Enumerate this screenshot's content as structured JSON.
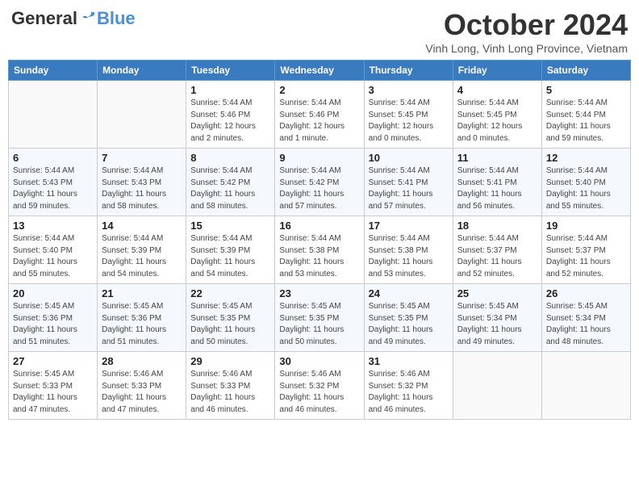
{
  "header": {
    "logo_general": "General",
    "logo_blue": "Blue",
    "month_title": "October 2024",
    "location": "Vinh Long, Vinh Long Province, Vietnam"
  },
  "days_of_week": [
    "Sunday",
    "Monday",
    "Tuesday",
    "Wednesday",
    "Thursday",
    "Friday",
    "Saturday"
  ],
  "weeks": [
    [
      {
        "day": "",
        "info": ""
      },
      {
        "day": "",
        "info": ""
      },
      {
        "day": "1",
        "info": "Sunrise: 5:44 AM\nSunset: 5:46 PM\nDaylight: 12 hours and 2 minutes."
      },
      {
        "day": "2",
        "info": "Sunrise: 5:44 AM\nSunset: 5:46 PM\nDaylight: 12 hours and 1 minute."
      },
      {
        "day": "3",
        "info": "Sunrise: 5:44 AM\nSunset: 5:45 PM\nDaylight: 12 hours and 0 minutes."
      },
      {
        "day": "4",
        "info": "Sunrise: 5:44 AM\nSunset: 5:45 PM\nDaylight: 12 hours and 0 minutes."
      },
      {
        "day": "5",
        "info": "Sunrise: 5:44 AM\nSunset: 5:44 PM\nDaylight: 11 hours and 59 minutes."
      }
    ],
    [
      {
        "day": "6",
        "info": "Sunrise: 5:44 AM\nSunset: 5:43 PM\nDaylight: 11 hours and 59 minutes."
      },
      {
        "day": "7",
        "info": "Sunrise: 5:44 AM\nSunset: 5:43 PM\nDaylight: 11 hours and 58 minutes."
      },
      {
        "day": "8",
        "info": "Sunrise: 5:44 AM\nSunset: 5:42 PM\nDaylight: 11 hours and 58 minutes."
      },
      {
        "day": "9",
        "info": "Sunrise: 5:44 AM\nSunset: 5:42 PM\nDaylight: 11 hours and 57 minutes."
      },
      {
        "day": "10",
        "info": "Sunrise: 5:44 AM\nSunset: 5:41 PM\nDaylight: 11 hours and 57 minutes."
      },
      {
        "day": "11",
        "info": "Sunrise: 5:44 AM\nSunset: 5:41 PM\nDaylight: 11 hours and 56 minutes."
      },
      {
        "day": "12",
        "info": "Sunrise: 5:44 AM\nSunset: 5:40 PM\nDaylight: 11 hours and 55 minutes."
      }
    ],
    [
      {
        "day": "13",
        "info": "Sunrise: 5:44 AM\nSunset: 5:40 PM\nDaylight: 11 hours and 55 minutes."
      },
      {
        "day": "14",
        "info": "Sunrise: 5:44 AM\nSunset: 5:39 PM\nDaylight: 11 hours and 54 minutes."
      },
      {
        "day": "15",
        "info": "Sunrise: 5:44 AM\nSunset: 5:39 PM\nDaylight: 11 hours and 54 minutes."
      },
      {
        "day": "16",
        "info": "Sunrise: 5:44 AM\nSunset: 5:38 PM\nDaylight: 11 hours and 53 minutes."
      },
      {
        "day": "17",
        "info": "Sunrise: 5:44 AM\nSunset: 5:38 PM\nDaylight: 11 hours and 53 minutes."
      },
      {
        "day": "18",
        "info": "Sunrise: 5:44 AM\nSunset: 5:37 PM\nDaylight: 11 hours and 52 minutes."
      },
      {
        "day": "19",
        "info": "Sunrise: 5:44 AM\nSunset: 5:37 PM\nDaylight: 11 hours and 52 minutes."
      }
    ],
    [
      {
        "day": "20",
        "info": "Sunrise: 5:45 AM\nSunset: 5:36 PM\nDaylight: 11 hours and 51 minutes."
      },
      {
        "day": "21",
        "info": "Sunrise: 5:45 AM\nSunset: 5:36 PM\nDaylight: 11 hours and 51 minutes."
      },
      {
        "day": "22",
        "info": "Sunrise: 5:45 AM\nSunset: 5:35 PM\nDaylight: 11 hours and 50 minutes."
      },
      {
        "day": "23",
        "info": "Sunrise: 5:45 AM\nSunset: 5:35 PM\nDaylight: 11 hours and 50 minutes."
      },
      {
        "day": "24",
        "info": "Sunrise: 5:45 AM\nSunset: 5:35 PM\nDaylight: 11 hours and 49 minutes."
      },
      {
        "day": "25",
        "info": "Sunrise: 5:45 AM\nSunset: 5:34 PM\nDaylight: 11 hours and 49 minutes."
      },
      {
        "day": "26",
        "info": "Sunrise: 5:45 AM\nSunset: 5:34 PM\nDaylight: 11 hours and 48 minutes."
      }
    ],
    [
      {
        "day": "27",
        "info": "Sunrise: 5:45 AM\nSunset: 5:33 PM\nDaylight: 11 hours and 47 minutes."
      },
      {
        "day": "28",
        "info": "Sunrise: 5:46 AM\nSunset: 5:33 PM\nDaylight: 11 hours and 47 minutes."
      },
      {
        "day": "29",
        "info": "Sunrise: 5:46 AM\nSunset: 5:33 PM\nDaylight: 11 hours and 46 minutes."
      },
      {
        "day": "30",
        "info": "Sunrise: 5:46 AM\nSunset: 5:32 PM\nDaylight: 11 hours and 46 minutes."
      },
      {
        "day": "31",
        "info": "Sunrise: 5:46 AM\nSunset: 5:32 PM\nDaylight: 11 hours and 46 minutes."
      },
      {
        "day": "",
        "info": ""
      },
      {
        "day": "",
        "info": ""
      }
    ]
  ]
}
